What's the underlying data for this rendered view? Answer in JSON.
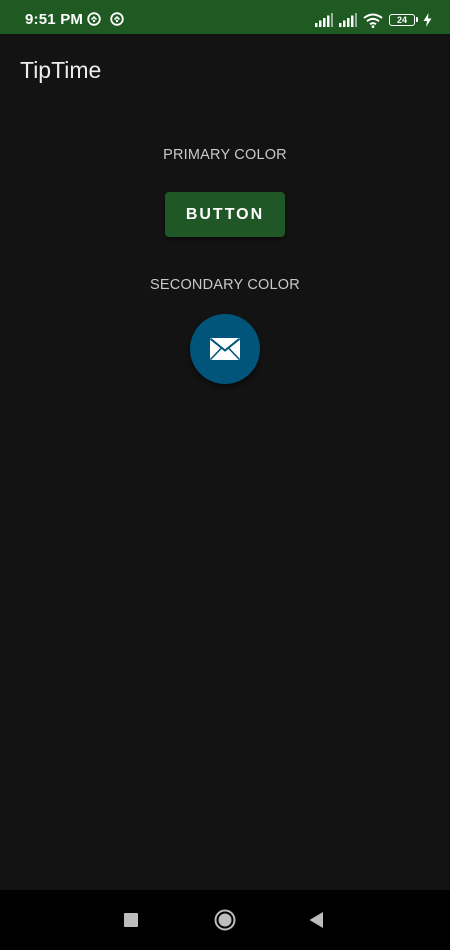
{
  "status_bar": {
    "time": "9:51 PM",
    "battery_level": "24",
    "notification_icons": [
      "circle-arrow-icon",
      "circle-arrow-icon"
    ],
    "right_icons": [
      "signal-icon",
      "signal-icon",
      "wifi-icon",
      "battery-icon",
      "charging-bolt-icon"
    ],
    "background_color": "#1e5a22"
  },
  "app_bar": {
    "title": "TipTime"
  },
  "main": {
    "primary_label": "PRIMARY COLOR",
    "button_label": "BUTTON",
    "secondary_label": "SECONDARY COLOR",
    "fab_icon": "email-icon",
    "primary_color": "#1f5726",
    "secondary_color": "#01557a"
  },
  "nav_bar": {
    "buttons": [
      "recents-icon",
      "home-icon",
      "back-icon"
    ]
  }
}
